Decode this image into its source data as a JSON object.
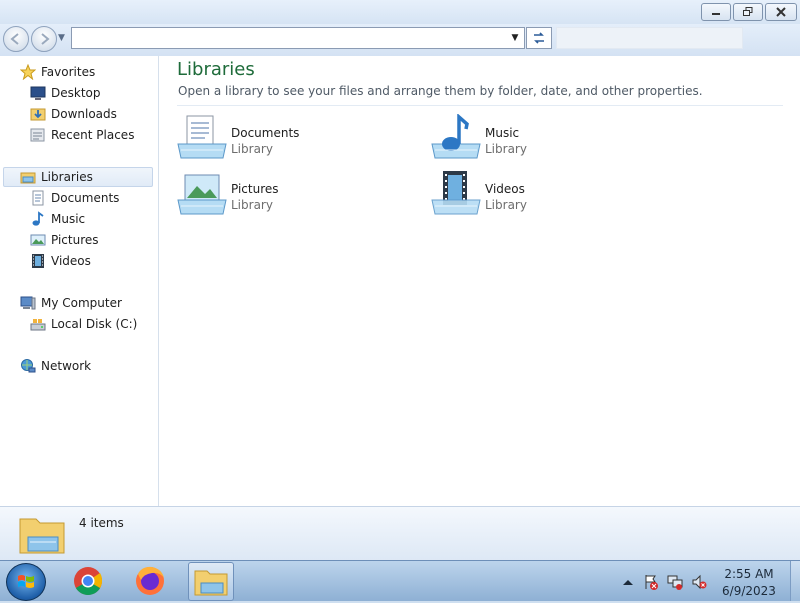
{
  "window": {
    "min_icon": "minimize-icon",
    "max_icon": "restore-icon",
    "close_icon": "close-icon"
  },
  "nav": {
    "address_value": "",
    "search_placeholder": ""
  },
  "sidebar": {
    "favorites": {
      "label": "Favorites",
      "items": [
        {
          "label": "Desktop"
        },
        {
          "label": "Downloads"
        },
        {
          "label": "Recent Places"
        }
      ]
    },
    "libraries": {
      "label": "Libraries",
      "items": [
        {
          "label": "Documents"
        },
        {
          "label": "Music"
        },
        {
          "label": "Pictures"
        },
        {
          "label": "Videos"
        }
      ]
    },
    "computer": {
      "label": "My Computer",
      "items": [
        {
          "label": "Local Disk (C:)"
        }
      ]
    },
    "network": {
      "label": "Network"
    }
  },
  "main": {
    "title": "Libraries",
    "description": "Open a library to see your files and arrange them by folder, date, and other properties.",
    "libraries": [
      {
        "name": "Documents",
        "type": "Library"
      },
      {
        "name": "Music",
        "type": "Library"
      },
      {
        "name": "Pictures",
        "type": "Library"
      },
      {
        "name": "Videos",
        "type": "Library"
      }
    ]
  },
  "details": {
    "count": "4 items"
  },
  "taskbar": {
    "time": "2:55 AM",
    "date": "6/9/2023"
  },
  "colors": {
    "title": "#1e6b3a",
    "selection": "#e1ebf7",
    "taskbar": "#9fbfe0"
  }
}
